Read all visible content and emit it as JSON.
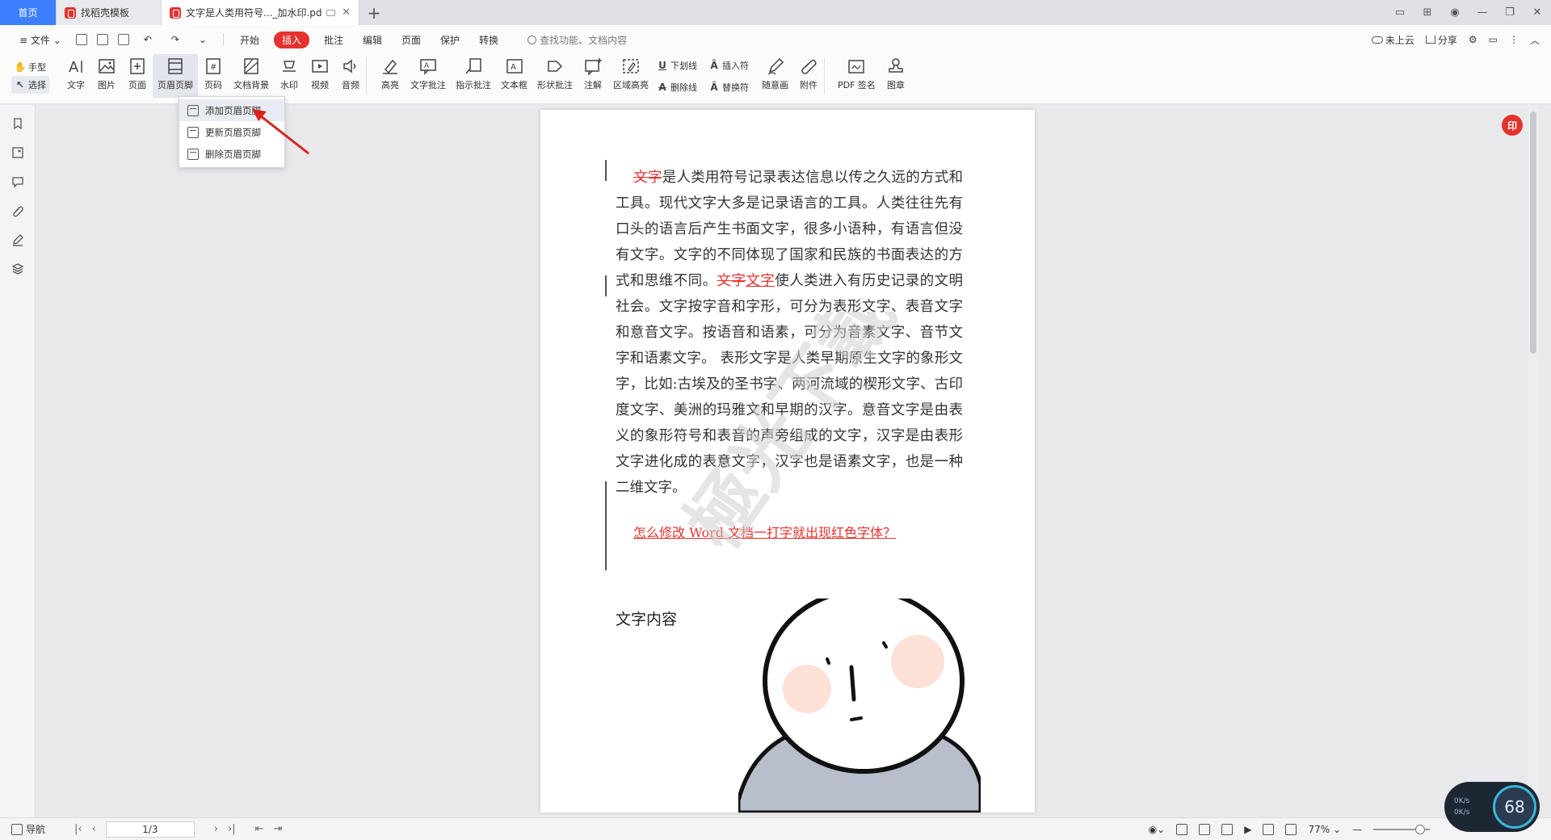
{
  "tabs": {
    "home": "首页",
    "template": "找稻壳模板",
    "document": "文字是人类用符号..._加水印.pdf",
    "add": "+"
  },
  "menubar": {
    "file": "文件",
    "tabs": [
      "开始",
      "插入",
      "批注",
      "编辑",
      "页面",
      "保护",
      "转换"
    ],
    "search_placeholder": "查找功能、文档内容",
    "cloud": "未上云",
    "share": "分享"
  },
  "ribbon": {
    "hand": "手型",
    "select": "选择",
    "text": "文字",
    "image": "图片",
    "page": "页面",
    "header_footer": "页眉页脚",
    "page_number": "页码",
    "doc_background": "文档背景",
    "watermark": "水印",
    "video": "视频",
    "audio": "音频",
    "highlight": "高亮",
    "text_comment": "文字批注",
    "pointer_comment": "指示批注",
    "textbox": "文本框",
    "shape_comment": "形状批注",
    "annotation": "注解",
    "area_highlight": "区域高亮",
    "underline": "下划线",
    "strikethrough": "删除线",
    "insert_symbol": "插入符",
    "replace_symbol": "替换符",
    "freehand": "随意画",
    "attachment": "附件",
    "pdf_sign": "PDF 签名",
    "stamp": "图章"
  },
  "dropdown": {
    "items": [
      "添加页眉页脚",
      "更新页眉页脚",
      "删除页眉页脚"
    ]
  },
  "document": {
    "p1_strike": "文字",
    "p1_rest": "是人类用符号记录表达信息以传之久远的方式和工具。现代文字大多是记录语言的工具。人类往往先有口头的语言后产生书面文字，很多小语种，有语言但没有文字。文字的不同体现了国家和民族的书面表达的方式和思维不同。",
    "p1_strike2": "文字",
    "p1_under": "文字",
    "p1_tail": "使人类进入有历史记录的文明社会。文字按字音和字形，可分为表形文字、表音文字和意音文字。按语音和语素，可分为音素文字、音节文字和语素文字。 表形文字是人类早期原生文字的象形文字，比如:古埃及的圣书字、两河流域的楔形文字、古印度文字、美洲的玛雅文和早期的汉字。意音文字是由表义的象形符号和表音的声旁组成的文字，汉字是由表形文字进化成的表意文字，汉字也是语素文字，也是一种二维文字。",
    "link": "怎么修改 Word 文档一打字就出现红色字体？",
    "heading": "文字内容",
    "watermark_text": "極光下載"
  },
  "statusbar": {
    "nav": "导航",
    "page": "1/3",
    "zoom": "77%"
  },
  "speed": {
    "up": "0K/s",
    "down": "0K/s",
    "value": "68"
  },
  "badge": "印",
  "colors": {
    "accent": "#3d7eff",
    "red": "#e5322d"
  }
}
